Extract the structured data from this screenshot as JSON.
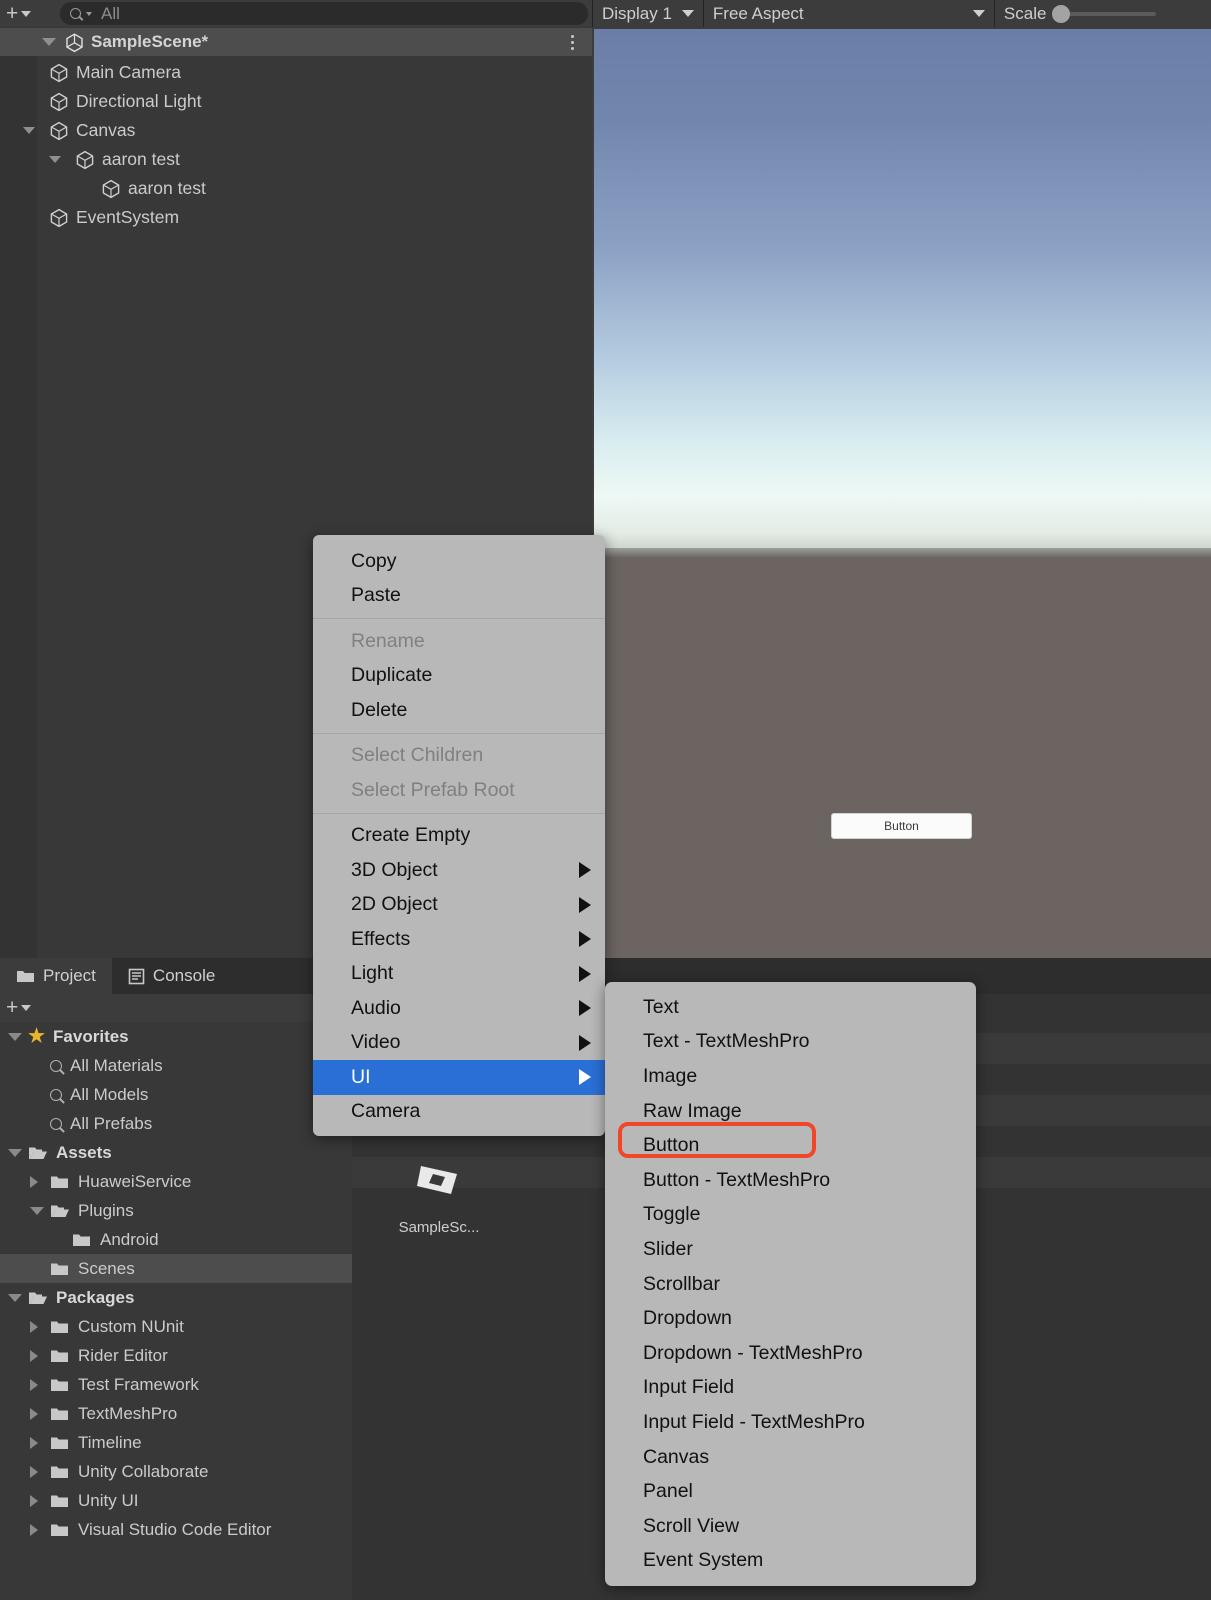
{
  "hierarchy": {
    "toolbar": {
      "add_label": "+",
      "search_placeholder": "All",
      "search_value": ""
    },
    "scene": {
      "name": "SampleScene*",
      "icon": "unity-scene-icon",
      "menu_icon": "kebab-menu-icon"
    },
    "items": [
      {
        "label": "Main Camera",
        "depth": 1,
        "expandable": false
      },
      {
        "label": "Directional Light",
        "depth": 1,
        "expandable": false
      },
      {
        "label": "Canvas",
        "depth": 1,
        "expandable": true
      },
      {
        "label": "aaron test",
        "depth": 2,
        "expandable": true
      },
      {
        "label": "aaron test",
        "depth": 3,
        "expandable": false
      },
      {
        "label": "EventSystem",
        "depth": 1,
        "expandable": false
      }
    ]
  },
  "gameview": {
    "display": "Display 1",
    "aspect": "Free Aspect",
    "scale_label": "Scale",
    "button_label": "Button",
    "sky_top_color": "#6a7ea7",
    "ground_color": "#6b6460"
  },
  "bottom_dock": {
    "tabs": [
      {
        "label": "Project",
        "icon": "folder-icon",
        "active": true
      },
      {
        "label": "Console",
        "icon": "console-icon",
        "active": false
      }
    ],
    "toolbar": {
      "add_label": "+"
    },
    "tree": [
      {
        "label": "Favorites",
        "kind": "favorites",
        "indent": 0,
        "arrow": "open",
        "bold": true,
        "selected": false
      },
      {
        "label": "All Materials",
        "kind": "search",
        "indent": 1,
        "arrow": "none",
        "bold": false,
        "selected": false
      },
      {
        "label": "All Models",
        "kind": "search",
        "indent": 1,
        "arrow": "none",
        "bold": false,
        "selected": false
      },
      {
        "label": "All Prefabs",
        "kind": "search",
        "indent": 1,
        "arrow": "none",
        "bold": false,
        "selected": false
      },
      {
        "label": "Assets",
        "kind": "folder-open",
        "indent": 0,
        "arrow": "open",
        "bold": true,
        "selected": false
      },
      {
        "label": "HuaweiService",
        "kind": "folder",
        "indent": 1,
        "arrow": "closed",
        "bold": false,
        "selected": false
      },
      {
        "label": "Plugins",
        "kind": "folder-open",
        "indent": 1,
        "arrow": "open",
        "bold": false,
        "selected": false
      },
      {
        "label": "Android",
        "kind": "folder",
        "indent": 2,
        "arrow": "none",
        "bold": false,
        "selected": false
      },
      {
        "label": "Scenes",
        "kind": "folder",
        "indent": 1,
        "arrow": "none",
        "bold": false,
        "selected": true
      },
      {
        "label": "Packages",
        "kind": "folder-open",
        "indent": 0,
        "arrow": "open",
        "bold": true,
        "selected": false
      },
      {
        "label": "Custom NUnit",
        "kind": "folder",
        "indent": 1,
        "arrow": "closed",
        "bold": false,
        "selected": false
      },
      {
        "label": "Rider Editor",
        "kind": "folder",
        "indent": 1,
        "arrow": "closed",
        "bold": false,
        "selected": false
      },
      {
        "label": "Test Framework",
        "kind": "folder",
        "indent": 1,
        "arrow": "closed",
        "bold": false,
        "selected": false
      },
      {
        "label": "TextMeshPro",
        "kind": "folder",
        "indent": 1,
        "arrow": "closed",
        "bold": false,
        "selected": false
      },
      {
        "label": "Timeline",
        "kind": "folder",
        "indent": 1,
        "arrow": "closed",
        "bold": false,
        "selected": false
      },
      {
        "label": "Unity Collaborate",
        "kind": "folder",
        "indent": 1,
        "arrow": "closed",
        "bold": false,
        "selected": false
      },
      {
        "label": "Unity UI",
        "kind": "folder",
        "indent": 1,
        "arrow": "closed",
        "bold": false,
        "selected": false
      },
      {
        "label": "Visual Studio Code Editor",
        "kind": "folder",
        "indent": 1,
        "arrow": "closed",
        "bold": false,
        "selected": false
      }
    ],
    "asset_grid": [
      {
        "label": "SampleSc...",
        "icon": "unity-scene-asset-icon"
      }
    ]
  },
  "context_menu": {
    "items": [
      {
        "label": "Copy",
        "disabled": false,
        "submenu": false,
        "highlighted": false
      },
      {
        "label": "Paste",
        "disabled": false,
        "submenu": false,
        "highlighted": false
      },
      {
        "separator": true
      },
      {
        "label": "Rename",
        "disabled": true,
        "submenu": false,
        "highlighted": false
      },
      {
        "label": "Duplicate",
        "disabled": false,
        "submenu": false,
        "highlighted": false
      },
      {
        "label": "Delete",
        "disabled": false,
        "submenu": false,
        "highlighted": false
      },
      {
        "separator": true
      },
      {
        "label": "Select Children",
        "disabled": true,
        "submenu": false,
        "highlighted": false
      },
      {
        "label": "Select Prefab Root",
        "disabled": true,
        "submenu": false,
        "highlighted": false
      },
      {
        "separator": true
      },
      {
        "label": "Create Empty",
        "disabled": false,
        "submenu": false,
        "highlighted": false
      },
      {
        "label": "3D Object",
        "disabled": false,
        "submenu": true,
        "highlighted": false
      },
      {
        "label": "2D Object",
        "disabled": false,
        "submenu": true,
        "highlighted": false
      },
      {
        "label": "Effects",
        "disabled": false,
        "submenu": true,
        "highlighted": false
      },
      {
        "label": "Light",
        "disabled": false,
        "submenu": true,
        "highlighted": false
      },
      {
        "label": "Audio",
        "disabled": false,
        "submenu": true,
        "highlighted": false
      },
      {
        "label": "Video",
        "disabled": false,
        "submenu": true,
        "highlighted": false
      },
      {
        "label": "UI",
        "disabled": false,
        "submenu": true,
        "highlighted": true
      },
      {
        "label": "Camera",
        "disabled": false,
        "submenu": false,
        "highlighted": false
      }
    ],
    "highlight_color": "#2a6fd6"
  },
  "ui_submenu": {
    "items": [
      {
        "label": "Text",
        "annotated": false
      },
      {
        "label": "Text - TextMeshPro",
        "annotated": false
      },
      {
        "label": "Image",
        "annotated": false
      },
      {
        "label": "Raw Image",
        "annotated": false
      },
      {
        "label": "Button",
        "annotated": true
      },
      {
        "label": "Button - TextMeshPro",
        "annotated": false
      },
      {
        "label": "Toggle",
        "annotated": false
      },
      {
        "label": "Slider",
        "annotated": false
      },
      {
        "label": "Scrollbar",
        "annotated": false
      },
      {
        "label": "Dropdown",
        "annotated": false
      },
      {
        "label": "Dropdown - TextMeshPro",
        "annotated": false
      },
      {
        "label": "Input Field",
        "annotated": false
      },
      {
        "label": "Input Field - TextMeshPro",
        "annotated": false
      },
      {
        "label": "Canvas",
        "annotated": false
      },
      {
        "label": "Panel",
        "annotated": false
      },
      {
        "label": "Scroll View",
        "annotated": false
      },
      {
        "label": "Event System",
        "annotated": false
      }
    ],
    "annotation_color": "#f0462a"
  }
}
